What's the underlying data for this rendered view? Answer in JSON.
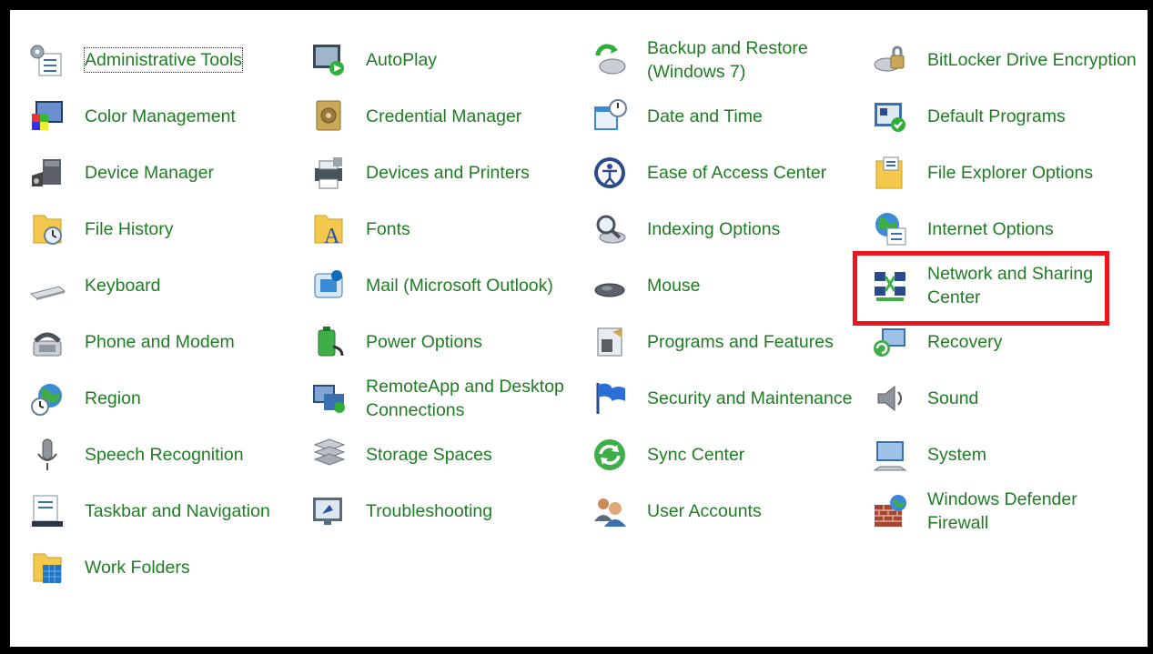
{
  "highlight_color": "#f0141e",
  "link_color": "#1e7d22",
  "items": [
    {
      "label": "Administrative Tools",
      "icon": "administrative-tools-icon"
    },
    {
      "label": "Color Management",
      "icon": "color-management-icon"
    },
    {
      "label": "Device Manager",
      "icon": "device-manager-icon"
    },
    {
      "label": "File History",
      "icon": "file-history-icon"
    },
    {
      "label": "Keyboard",
      "icon": "keyboard-icon"
    },
    {
      "label": "Phone and Modem",
      "icon": "phone-modem-icon"
    },
    {
      "label": "Region",
      "icon": "region-icon"
    },
    {
      "label": "Speech Recognition",
      "icon": "microphone-icon"
    },
    {
      "label": "Taskbar and Navigation",
      "icon": "taskbar-icon"
    },
    {
      "label": "Work Folders",
      "icon": "work-folders-icon"
    },
    {
      "label": "AutoPlay",
      "icon": "autoplay-icon"
    },
    {
      "label": "Credential Manager",
      "icon": "credential-manager-icon"
    },
    {
      "label": "Devices and Printers",
      "icon": "printer-icon"
    },
    {
      "label": "Fonts",
      "icon": "fonts-icon"
    },
    {
      "label": "Mail (Microsoft Outlook)",
      "icon": "mail-icon"
    },
    {
      "label": "Power Options",
      "icon": "power-options-icon"
    },
    {
      "label": "RemoteApp and Desktop\nConnections",
      "icon": "remoteapp-icon"
    },
    {
      "label": "Storage Spaces",
      "icon": "storage-spaces-icon"
    },
    {
      "label": "Troubleshooting",
      "icon": "troubleshooting-icon"
    },
    {
      "label": "Backup and Restore\n(Windows 7)",
      "icon": "backup-restore-icon"
    },
    {
      "label": "Date and Time",
      "icon": "date-time-icon"
    },
    {
      "label": "Ease of Access Center",
      "icon": "ease-of-access-icon"
    },
    {
      "label": "Indexing Options",
      "icon": "indexing-options-icon"
    },
    {
      "label": "Mouse",
      "icon": "mouse-icon"
    },
    {
      "label": "Programs and Features",
      "icon": "programs-features-icon"
    },
    {
      "label": "Security and Maintenance",
      "icon": "security-flag-icon"
    },
    {
      "label": "Sync Center",
      "icon": "sync-center-icon"
    },
    {
      "label": "User Accounts",
      "icon": "user-accounts-icon"
    },
    {
      "label": "BitLocker Drive Encryption",
      "icon": "bitlocker-icon"
    },
    {
      "label": "Default Programs",
      "icon": "default-programs-icon"
    },
    {
      "label": "File Explorer Options",
      "icon": "folder-options-icon"
    },
    {
      "label": "Internet Options",
      "icon": "internet-options-icon"
    },
    {
      "label": "Network and Sharing\nCenter",
      "icon": "network-sharing-icon"
    },
    {
      "label": "Recovery",
      "icon": "recovery-icon"
    },
    {
      "label": "Sound",
      "icon": "speaker-icon"
    },
    {
      "label": "System",
      "icon": "system-icon"
    },
    {
      "label": "Windows Defender\nFirewall",
      "icon": "firewall-icon"
    }
  ]
}
